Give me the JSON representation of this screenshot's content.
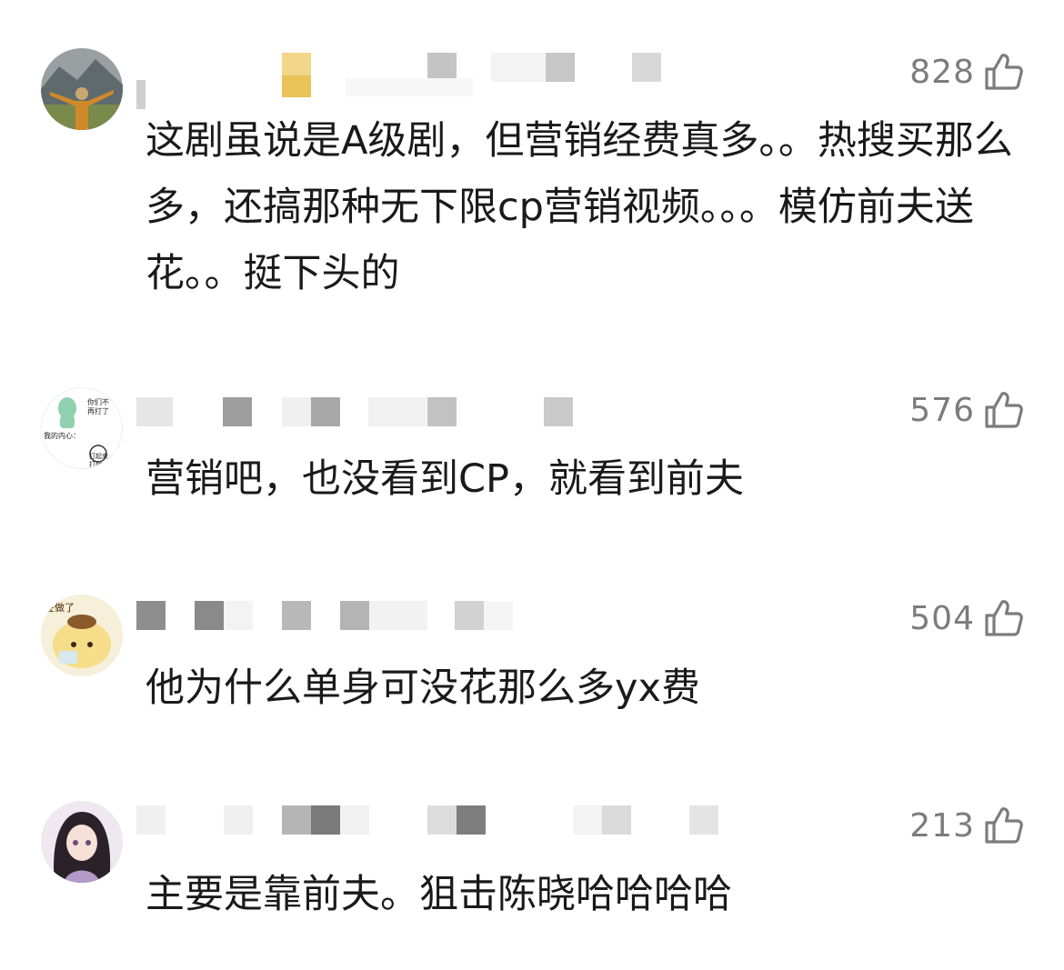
{
  "comments": [
    {
      "likes": "828",
      "text": "这剧虽说是A级剧，但营销经费真多。。热搜买那么多，还搞那种无下限cp营销视频。。。模仿前夫送花。。挺下头的",
      "avatar_icon": "mountain-person-avatar-icon"
    },
    {
      "likes": "576",
      "text": "营销吧，也没看到CP，就看到前夫",
      "avatar_text_1": "你们不",
      "avatar_text_2": "再打了",
      "avatar_text_3": "我的内心：",
      "avatar_text_4": "打起来",
      "avatar_text_5": "打起",
      "avatar_icon": "meme-avatar-icon"
    },
    {
      "likes": "504",
      "text": "他为什么单身可没花那么多yx费",
      "avatar_text_1": "在做了",
      "avatar_icon": "pompompurin-avatar-icon"
    },
    {
      "likes": "213",
      "text": "主要是靠前夫。狙击陈晓哈哈哈哈",
      "avatar_icon": "anime-girl-avatar-icon"
    }
  ],
  "icons": {
    "like": "thumbs-up-icon"
  },
  "colors": {
    "like_count": "#7c7c7c",
    "text": "#1a1a1a",
    "background": "#ffffff"
  }
}
